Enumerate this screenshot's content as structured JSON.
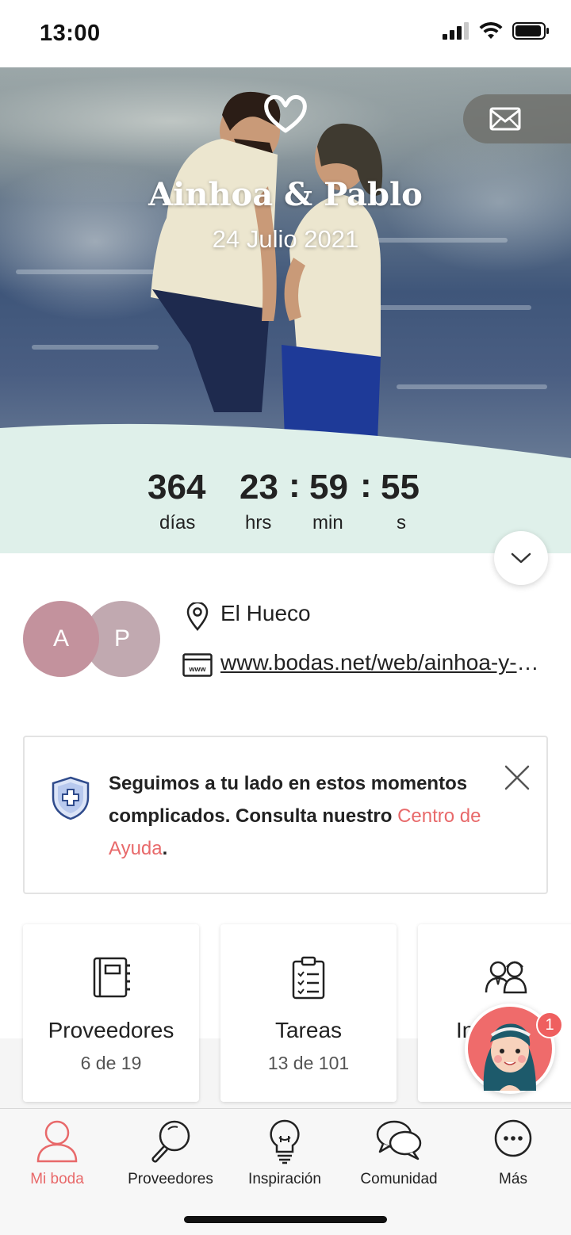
{
  "status_bar": {
    "time": "13:00"
  },
  "hero": {
    "names": "Ainhoa & Pablo",
    "date": "24 Julio 2021",
    "icons": [
      "heart-icon",
      "mail-icon"
    ]
  },
  "countdown": {
    "days": "364",
    "days_label": "días",
    "hours": "23",
    "hours_label": "hrs",
    "minutes": "59",
    "minutes_label": "min",
    "seconds": "55",
    "seconds_label": "s",
    "separator": ":"
  },
  "couple": {
    "avatar_a": "A",
    "avatar_p": "P",
    "venue": "El Hueco",
    "website": "www.bodas.net/web/ainhoa-y-pablo"
  },
  "banner": {
    "text": "Seguimos a tu lado en estos momentos complicados. Consulta nuestro ",
    "link": "Centro de Ayuda",
    "end": "."
  },
  "cards": [
    {
      "title": "Proveedores",
      "count": "6 de 19",
      "icon": "address-book-icon"
    },
    {
      "title": "Tareas",
      "count": "13 de 101",
      "icon": "clipboard-checklist-icon"
    },
    {
      "title": "In",
      "count": "",
      "icon": "guests-icon"
    }
  ],
  "assistant": {
    "badge": "1"
  },
  "nav": [
    {
      "label": "Mi boda",
      "icon": "user-icon",
      "active": true
    },
    {
      "label": "Proveedores",
      "icon": "search-icon"
    },
    {
      "label": "Inspiración",
      "icon": "lightbulb-icon"
    },
    {
      "label": "Comunidad",
      "icon": "chat-bubbles-icon"
    },
    {
      "label": "Más",
      "icon": "more-icon"
    }
  ],
  "colors": {
    "accent": "#e8696a",
    "countdown_bg": "#dff0ea",
    "avatar_a": "#c3929d",
    "avatar_p": "#c1a9b0"
  }
}
